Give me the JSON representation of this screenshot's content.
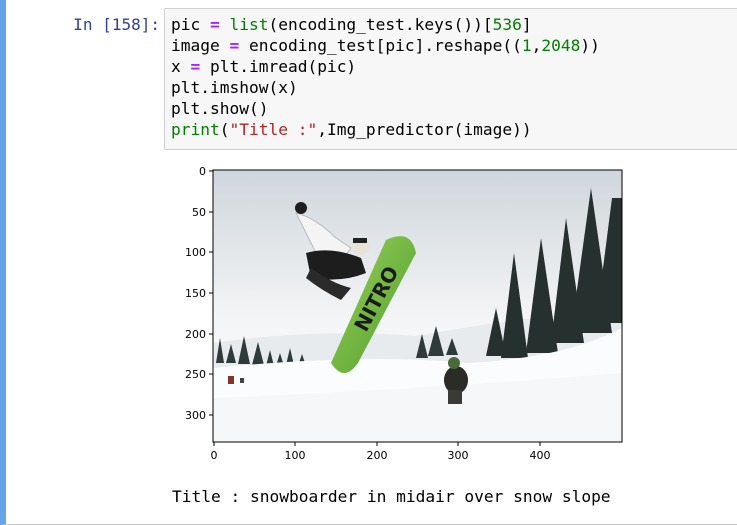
{
  "cell": {
    "prompt": "In [158]:",
    "code": {
      "line1": {
        "a": "pic ",
        "eq": "=",
        "b": " ",
        "fn": "list",
        "c": "(encoding_test.keys())[",
        "n": "536",
        "d": "]"
      },
      "line2": {
        "a": "image ",
        "eq": "=",
        "b": " encoding_test[pic].reshape((",
        "n1": "1",
        "c": ",",
        "n2": "2048",
        "d": "))"
      },
      "line3": {
        "a": "x ",
        "eq": "=",
        "b": " plt.imread(pic)"
      },
      "line4": "plt.imshow(x)",
      "line5": "plt.show()",
      "line6": {
        "fn": "print",
        "a": "(",
        "str": "\"Title :\"",
        "b": ",Img_predictor(image))"
      }
    }
  },
  "output": {
    "title_text": "Title : snowboarder in midair over snow slope"
  },
  "chart_data": {
    "type": "image",
    "x_ticks": [
      "0",
      "100",
      "200",
      "300",
      "400"
    ],
    "y_ticks": [
      "0",
      "50",
      "100",
      "150",
      "200",
      "250",
      "300"
    ],
    "xlim": [
      0,
      500
    ],
    "ylim": [
      333,
      0
    ],
    "image_subject": "snowboarder in midair with green board over snowy slope with pine trees"
  },
  "colors": {
    "prompt": "#303f9f",
    "cell_border": "#66a3e8",
    "code_bg": "#f7f7f7",
    "board_green": "#7cc24a"
  }
}
